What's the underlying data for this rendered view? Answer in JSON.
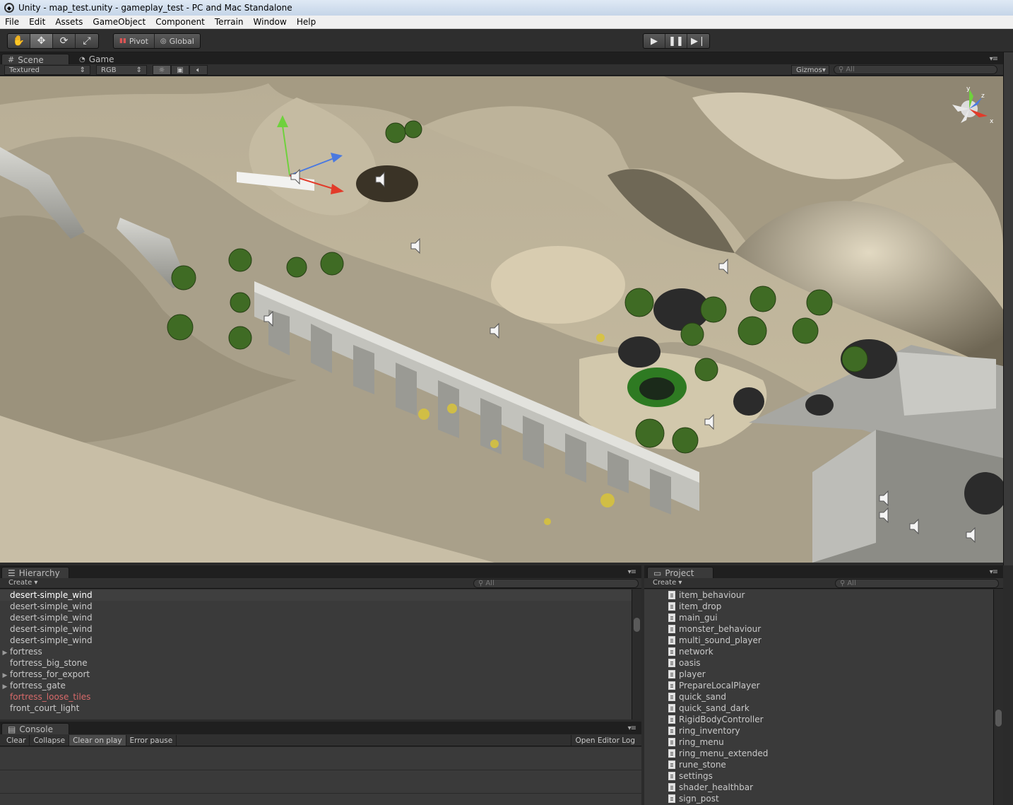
{
  "window": {
    "title": "Unity - map_test.unity - gameplay_test - PC and Mac Standalone"
  },
  "menu": [
    "File",
    "Edit",
    "Assets",
    "GameObject",
    "Component",
    "Terrain",
    "Window",
    "Help"
  ],
  "toolbar": {
    "pivot_label": "Pivot",
    "global_label": "Global"
  },
  "scene_tabs": [
    {
      "label": "Scene",
      "active": true
    },
    {
      "label": "Game",
      "active": false
    }
  ],
  "scene_controls": {
    "render_mode": "Textured",
    "color_mode": "RGB",
    "gizmos_label": "Gizmos",
    "search_placeholder": "All"
  },
  "gizmo_axes": {
    "y": "y",
    "z": "z",
    "x": "x"
  },
  "hierarchy": {
    "title": "Hierarchy",
    "create_label": "Create",
    "search_placeholder": "All",
    "items": [
      {
        "label": "desert-simple_wind",
        "expandable": false,
        "state": "selected"
      },
      {
        "label": "desert-simple_wind",
        "expandable": false,
        "state": "normal"
      },
      {
        "label": "desert-simple_wind",
        "expandable": false,
        "state": "normal"
      },
      {
        "label": "desert-simple_wind",
        "expandable": false,
        "state": "normal"
      },
      {
        "label": "desert-simple_wind",
        "expandable": false,
        "state": "normal"
      },
      {
        "label": "fortress",
        "expandable": true,
        "state": "normal"
      },
      {
        "label": "fortress_big_stone",
        "expandable": false,
        "state": "normal"
      },
      {
        "label": "fortress_for_export",
        "expandable": true,
        "state": "normal"
      },
      {
        "label": "fortress_gate",
        "expandable": true,
        "state": "normal"
      },
      {
        "label": "fortress_loose_tiles",
        "expandable": false,
        "state": "warning"
      },
      {
        "label": "front_court_light",
        "expandable": false,
        "state": "normal"
      }
    ]
  },
  "console": {
    "title": "Console",
    "buttons": [
      {
        "label": "Clear",
        "active": false
      },
      {
        "label": "Collapse",
        "active": false
      },
      {
        "label": "Clear on play",
        "active": true
      },
      {
        "label": "Error pause",
        "active": false
      }
    ],
    "open_log_label": "Open Editor Log"
  },
  "project": {
    "title": "Project",
    "create_label": "Create",
    "search_placeholder": "All",
    "items": [
      "item_behaviour",
      "item_drop",
      "main_gui",
      "monster_behaviour",
      "multi_sound_player",
      "network",
      "oasis",
      "player",
      "PrepareLocalPlayer",
      "quick_sand",
      "quick_sand_dark",
      "RigidBodyController",
      "ring_inventory",
      "ring_menu",
      "ring_menu_extended",
      "rune_stone",
      "settings",
      "shader_healthbar",
      "sign_post"
    ]
  },
  "colors": {
    "sand_light": "#d9cfb6",
    "sand_shadow": "#7c7462",
    "stone": "#b4b4ae",
    "palm": "#3f6b24",
    "rock": "#2c2c2c",
    "warning_text": "#d86a6a"
  }
}
